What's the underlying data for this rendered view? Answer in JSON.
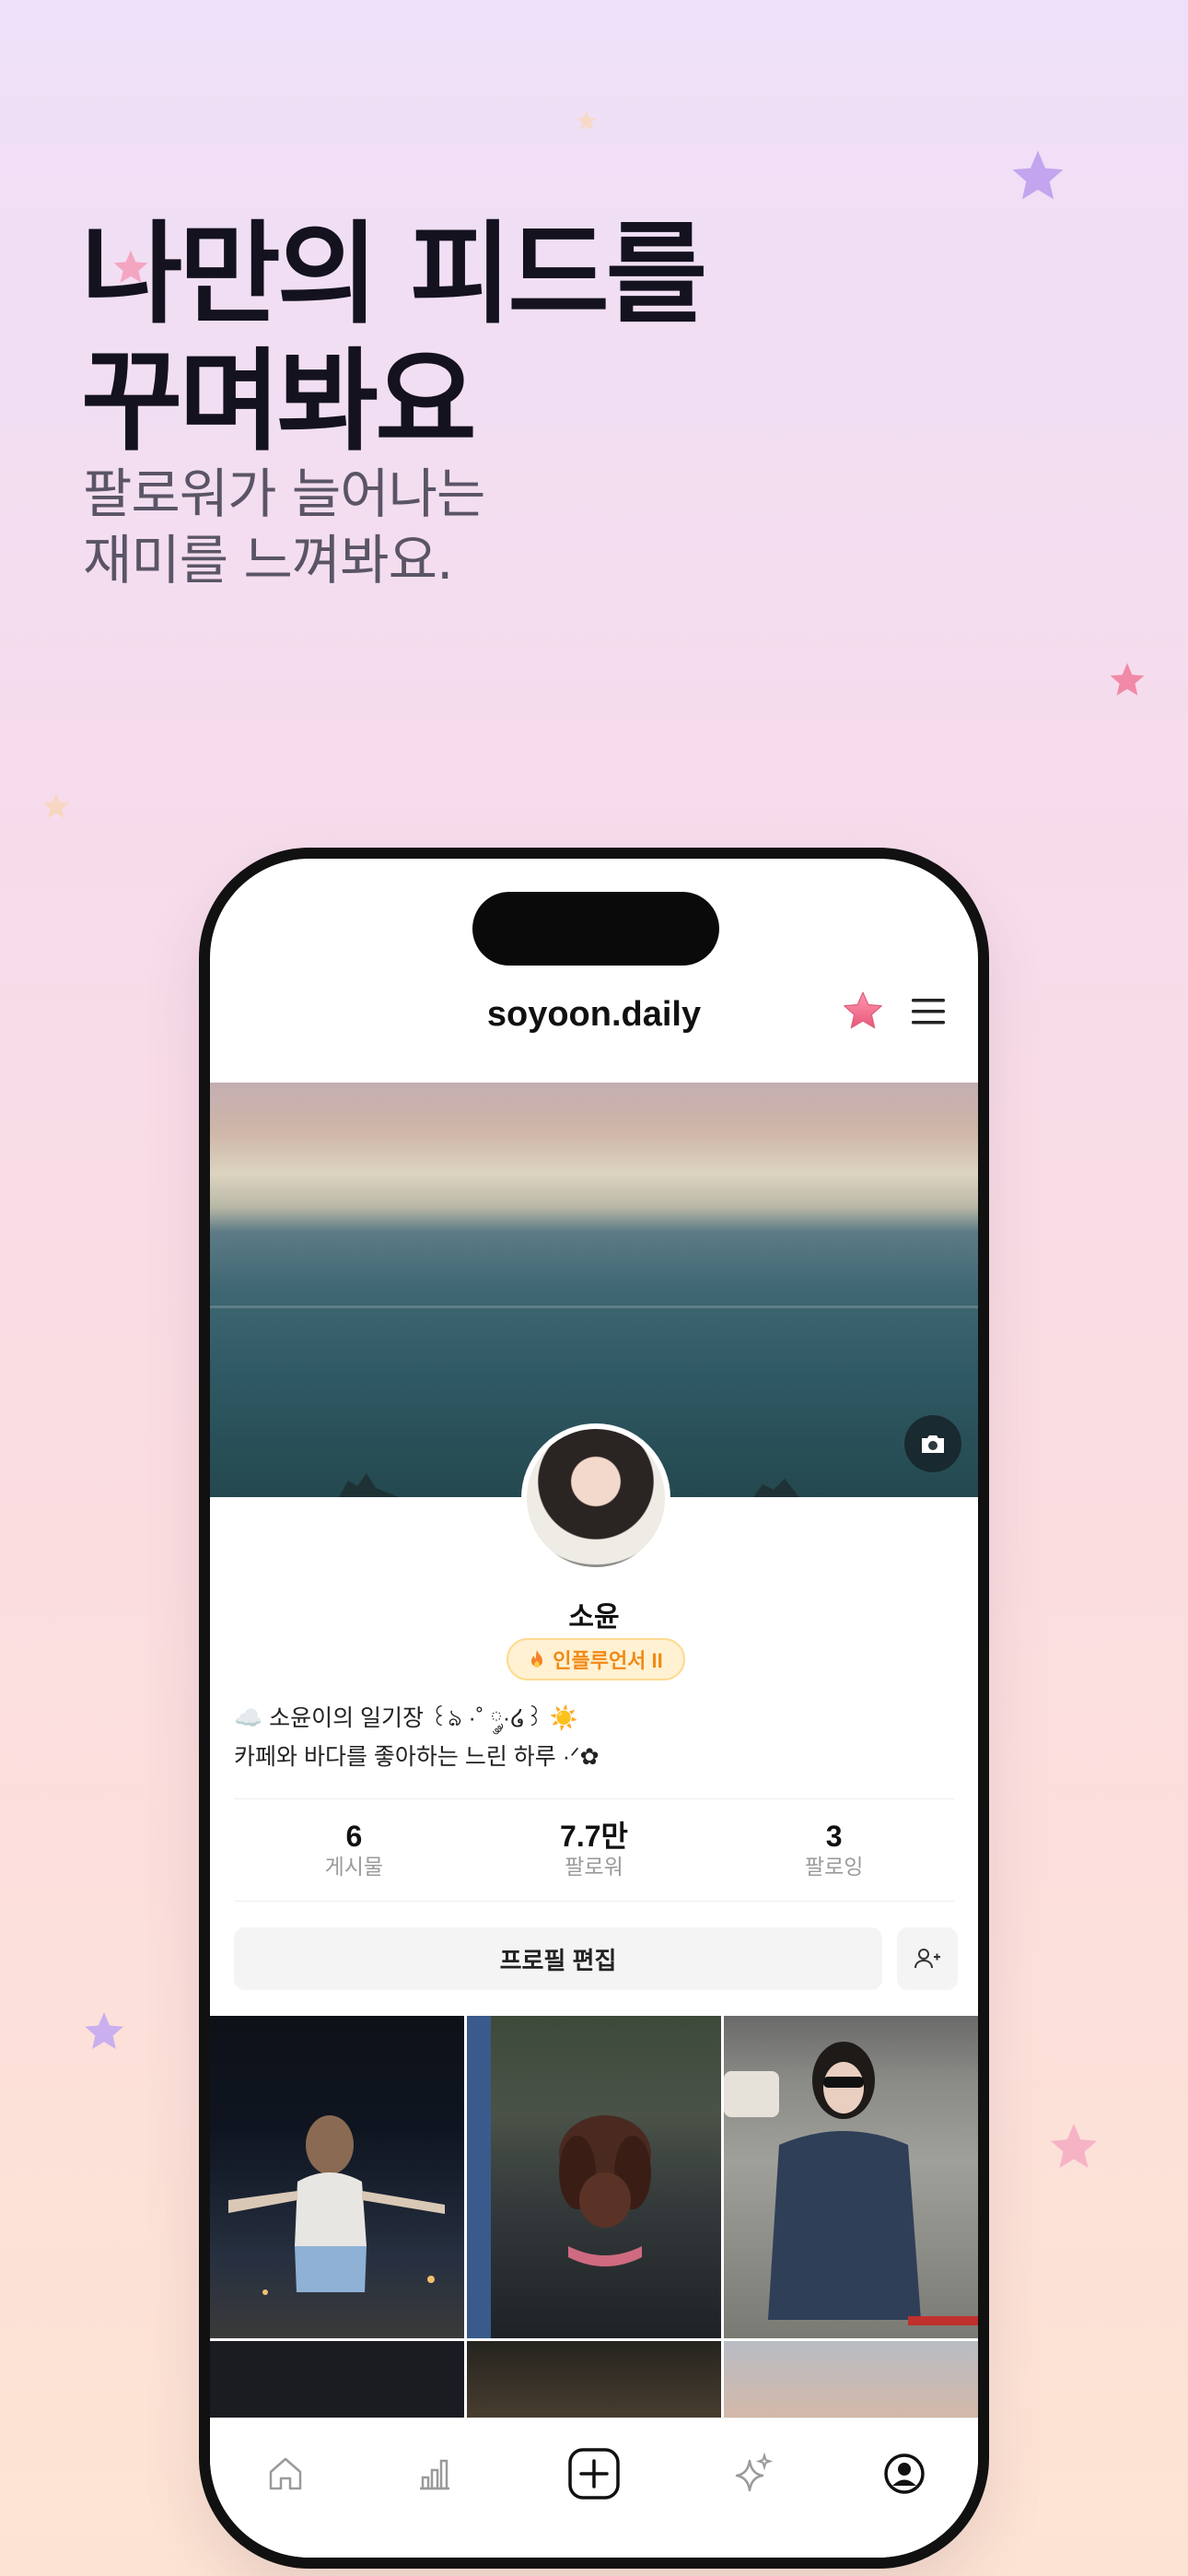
{
  "headline": {
    "line1": "나만의 피드를",
    "line2": "꾸며봐요"
  },
  "subline": {
    "line1": "팔로워가 늘어나는",
    "line2": "재미를 느껴봐요."
  },
  "colors": {
    "accent_star": "#f0708a",
    "badge_text": "#f08a16",
    "badge_bg": "#fff1d2"
  },
  "phone": {
    "topbar": {
      "username": "soyoon.daily",
      "star_icon": "star-icon",
      "menu_icon": "hamburger-menu-icon"
    },
    "cover": {
      "camera_icon": "camera-icon"
    },
    "profile": {
      "name": "소윤",
      "badge": "인플루언서 II",
      "badge_icon": "fire-icon",
      "bio_line1": "☁️ 소윤이의 일기장 ꒰ঌ ·˚ ༘·໒꒱ ☀️",
      "bio_line2": "카페와 바다를 좋아하는 느린 하루 ·ᐟ✿"
    },
    "stats": [
      {
        "value": "6",
        "label": "게시물"
      },
      {
        "value": "7.7만",
        "label": "팔로워"
      },
      {
        "value": "3",
        "label": "팔로잉"
      }
    ],
    "actions": {
      "edit_profile": "프로필 편집",
      "add_friend_icon": "add-person-icon"
    },
    "tabs": [
      {
        "icon": "home-icon"
      },
      {
        "icon": "chart-icon"
      },
      {
        "icon": "plus-square-icon"
      },
      {
        "icon": "sparkle-icon"
      },
      {
        "icon": "profile-circle-icon"
      }
    ]
  }
}
